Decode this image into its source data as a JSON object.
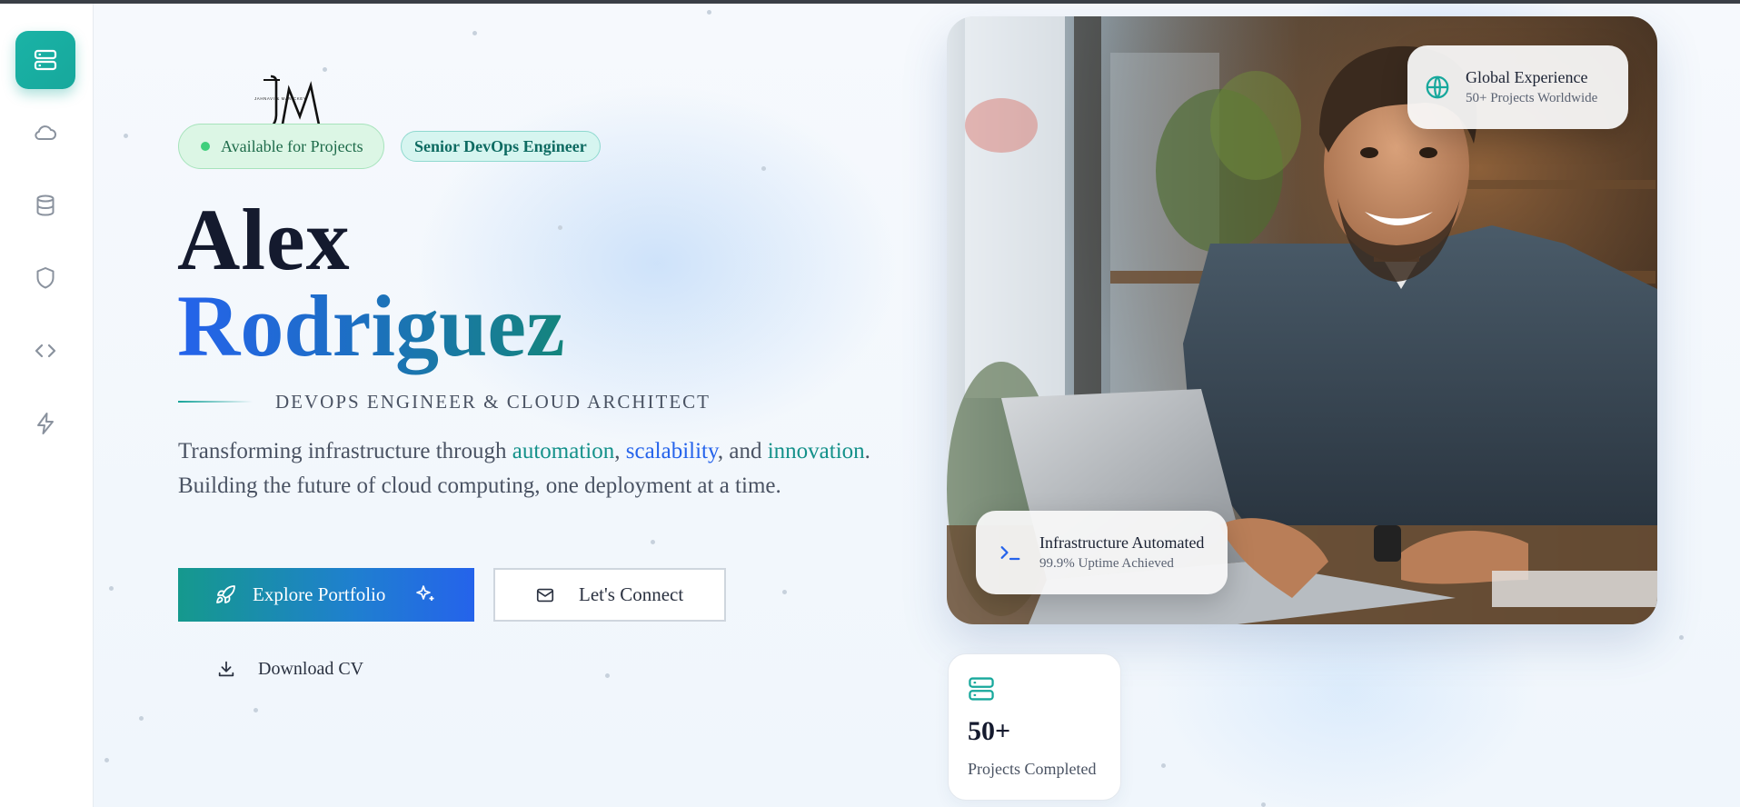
{
  "sidebar": {
    "items": [
      {
        "icon": "server-icon",
        "active": true
      },
      {
        "icon": "cloud-icon",
        "active": false
      },
      {
        "icon": "database-icon",
        "active": false
      },
      {
        "icon": "shield-icon",
        "active": false
      },
      {
        "icon": "code-icon",
        "active": false
      },
      {
        "icon": "lightning-icon",
        "active": false
      }
    ]
  },
  "logo": {
    "text": "JAHNAVI & MANICKEY"
  },
  "badges": {
    "available": "Available for Projects",
    "role": "Senior DevOps Engineer"
  },
  "hero": {
    "first_name": "Alex",
    "last_name": "Rodriguez",
    "subtitle": "DevOps Engineer & Cloud Architect",
    "description": {
      "part1": "Transforming infrastructure through ",
      "hl1": "automation",
      "sep1": ", ",
      "hl2": "scalability",
      "sep2": ", and ",
      "hl3": "innovation",
      "part2": ". Building the future of cloud computing, one deployment at a time."
    }
  },
  "buttons": {
    "explore": "Explore Portfolio",
    "connect": "Let's Connect",
    "download": "Download CV"
  },
  "cards": {
    "global": {
      "title": "Global Experience",
      "sub": "50+ Projects Worldwide"
    },
    "infra": {
      "title": "Infrastructure Automated",
      "sub": "99.9% Uptime Achieved"
    }
  },
  "stats": {
    "projects": {
      "value": "50+",
      "label": "Projects Completed"
    }
  },
  "colors": {
    "accent_teal": "#17a89c",
    "accent_blue": "#2563eb",
    "text_dark": "#141a2e"
  }
}
